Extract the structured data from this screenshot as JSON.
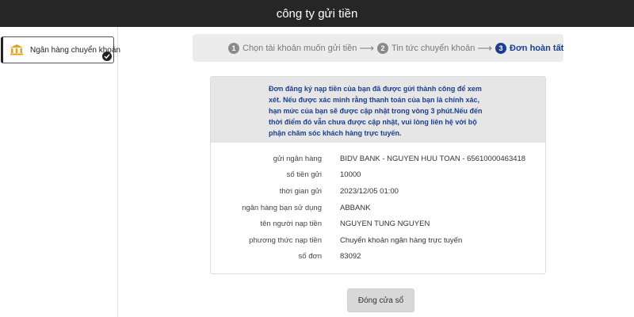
{
  "header": {
    "title": "công ty gửi tiền"
  },
  "sidebar": {
    "items": [
      {
        "label": "Ngân hàng chuyển khoản",
        "icon": "bank-icon",
        "selected": true
      }
    ]
  },
  "steps": [
    {
      "num": "1",
      "label": "Chọn tài khoản muốn gửi tiền",
      "active": false
    },
    {
      "num": "2",
      "label": "Tin tức chuyển khoản",
      "active": false
    },
    {
      "num": "3",
      "label": "Đơn hoàn tất",
      "active": true
    }
  ],
  "notice": {
    "line1": "Đơn đăng ký nạp tiền của bạn đã được gửi thành công để xem",
    "line2": "xét. Nếu được xác minh rằng thanh toán của bạn là chính xác,",
    "line3": "hạn mức của bạn sẽ được cập nhật trong vòng 3 phút.Nếu đến",
    "line4": "thời điểm đó vẫn chưa được cập nhật, vui lòng liên hệ với bộ",
    "line5": "phận chăm sóc khách hàng trực tuyến."
  },
  "details": [
    {
      "label": "gửi ngân hàng",
      "value": "BIDV BANK - NGUYEN HUU TOAN - 65610000463418"
    },
    {
      "label": "số tiền gửi",
      "value": "10000"
    },
    {
      "label": "thời gian gửi",
      "value": "2023/12/05 01:00"
    },
    {
      "label": "ngân hàng bạn sử dụng",
      "value": "ABBANK"
    },
    {
      "label": "tên người nạp tiền",
      "value": "NGUYEN TUNG NGUYEN"
    },
    {
      "label": "phương thức nạp tiền",
      "value": "Chuyển khoản ngân hàng trực tuyến"
    },
    {
      "label": "số đơn",
      "value": "83092"
    }
  ],
  "close_button": {
    "label": "Đóng cửa sổ"
  },
  "colors": {
    "topbar": "#262626",
    "accent": "#1d3f8f",
    "notice_bg": "#e6e6e6",
    "step_bar_bg": "#ececec"
  }
}
